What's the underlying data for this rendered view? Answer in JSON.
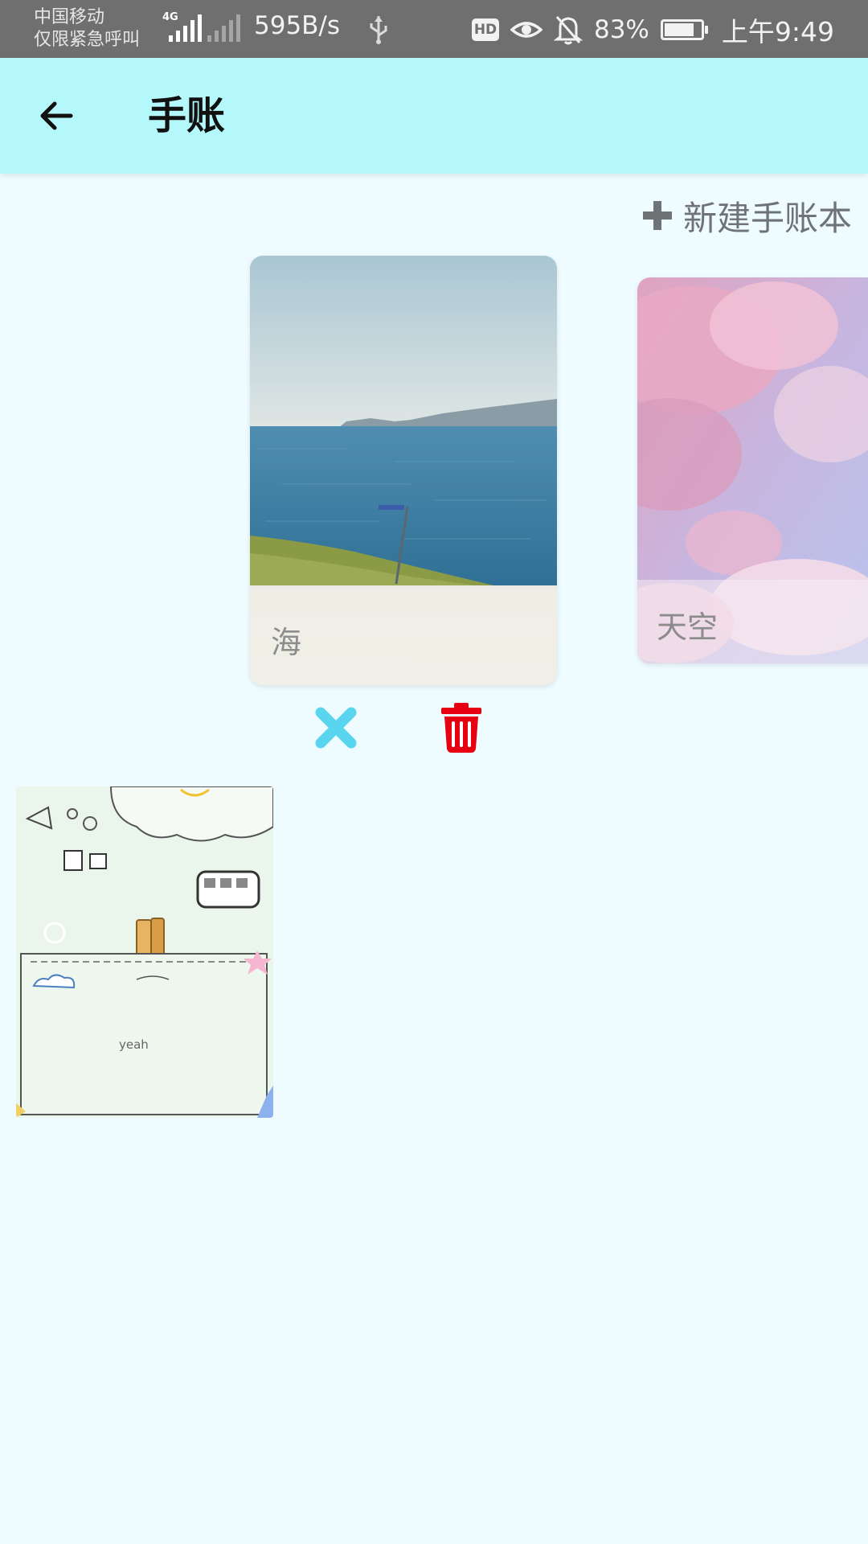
{
  "status_bar": {
    "carrier_line1": "中国移动",
    "carrier_line2": "仅限紧急呼叫",
    "network_type": "4G",
    "net_speed": "595B/s",
    "battery_percent": "83%",
    "battery_level": 0.83,
    "time": "上午9:49"
  },
  "app_bar": {
    "title": "手账"
  },
  "actions": {
    "new_book_label": "新建手账本"
  },
  "notebooks": [
    {
      "title": "海",
      "cover": "sea-landscape",
      "state": "selected"
    },
    {
      "title": "天空",
      "cover": "pink-clouds"
    },
    {
      "title": "yeah",
      "cover": "doodle-paper"
    }
  ],
  "card_actions": {
    "cancel_icon": "close-icon",
    "delete_icon": "trash-icon"
  },
  "colors": {
    "app_bar": "#b5f8fb",
    "background": "#eefbff",
    "status_bar": "#6f6f6f",
    "close_icon": "#59d5ef",
    "delete_icon": "#e60012"
  }
}
